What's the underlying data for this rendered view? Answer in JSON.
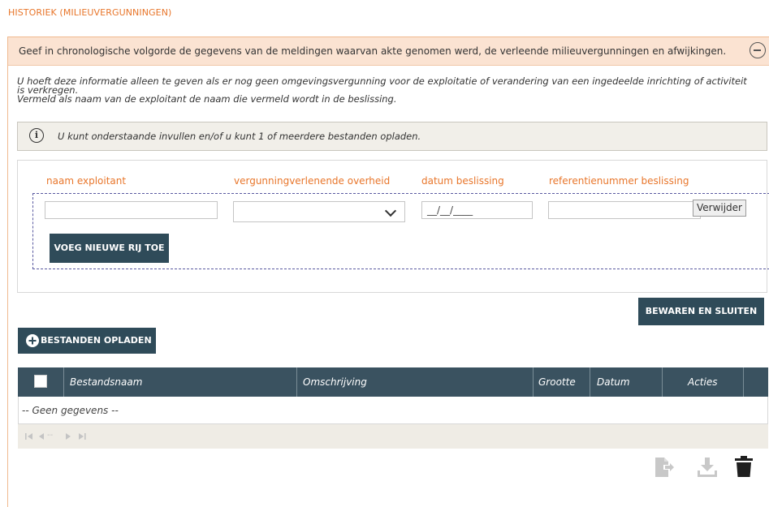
{
  "page": {
    "title": "HISTORIEK (MILIEUVERGUNNINGEN)"
  },
  "intro": {
    "text": "Geef in chronologische volgorde de gegevens van de meldingen waarvan akte genomen werd, de verleende milieuvergunningen en afwijkingen."
  },
  "help": {
    "line1": "U hoeft deze informatie alleen te geven als er nog geen omgevingsvergunning voor de exploitatie of verandering van een ingedeelde inrichting of activiteit",
    "line2": "is verkregen.",
    "line3": "Vermeld als naam van de exploitant de naam die vermeld wordt in de beslissing."
  },
  "info": {
    "icon": "i",
    "text": "U kunt onderstaande invullen en/of u kunt 1 of meerdere bestanden opladen."
  },
  "form": {
    "headers": {
      "naam": "naam exploitant",
      "overheid": "vergunningverlenende overheid",
      "datum": "datum beslissing",
      "referentie": "referentienummer beslissing"
    },
    "row": {
      "naam_value": "",
      "overheid_value": "",
      "datum_placeholder": "__/__/____",
      "referentie_value": "",
      "remove_label": "Verwijder"
    },
    "add_row_label": "VOEG NIEUWE RIJ TOE"
  },
  "save_close_label": "BEWAREN EN SLUITEN",
  "upload_label": "BESTANDEN OPLADEN",
  "table": {
    "columns": [
      "Bestandsnaam",
      "Omschrijving",
      "Grootte",
      "Datum",
      "Acties"
    ],
    "empty_text": "-- Geen gegevens --",
    "pager_text": "-- "
  },
  "colors": {
    "accent": "#e8762b",
    "header_dark": "#3a5260",
    "button_dark": "#2f4b59",
    "intro_bg": "#fbe3d2"
  },
  "icons": [
    "collapse-icon",
    "info-icon",
    "chevron-down-icon",
    "plus-circle-icon",
    "first-page-icon",
    "prev-page-icon",
    "next-page-icon",
    "last-page-icon",
    "export-icon",
    "download-icon",
    "trash-icon"
  ]
}
